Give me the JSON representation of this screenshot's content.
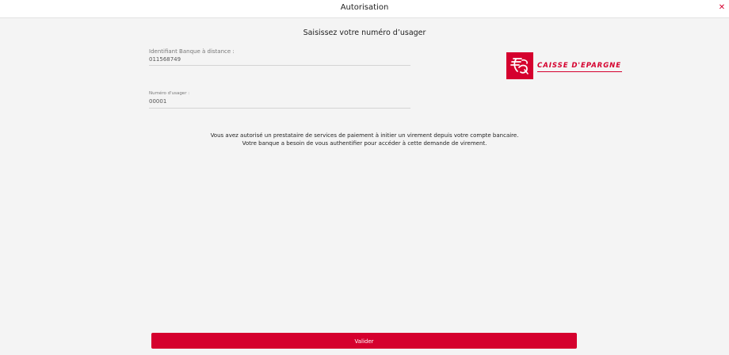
{
  "header": {
    "title": "Autorisation",
    "close_icon": "close-icon",
    "close_glyph": "✕"
  },
  "page": {
    "subtitle": "Saisissez votre numéro d’usager"
  },
  "form": {
    "remote_banking_id": {
      "label": "Identifiant Banque à distance :",
      "value": "011568749"
    },
    "user_number": {
      "label": "Numéro d'usager :",
      "value": "00001"
    }
  },
  "logo": {
    "text": "CAISSE D'EPARGNE",
    "icon": "squirrel-logo-icon",
    "color": "#d5002e"
  },
  "info": {
    "line1": "Vous avez autorisé un prestataire de services de paiement à initier un virement depuis votre compte bancaire.",
    "line2": "Votre banque a besoin de vous authentifier pour accéder à cette demande de virement."
  },
  "actions": {
    "validate_label": "Valider"
  },
  "colors": {
    "accent": "#d5002e",
    "background": "#f4f4f4",
    "header_bg": "#ffffff"
  }
}
